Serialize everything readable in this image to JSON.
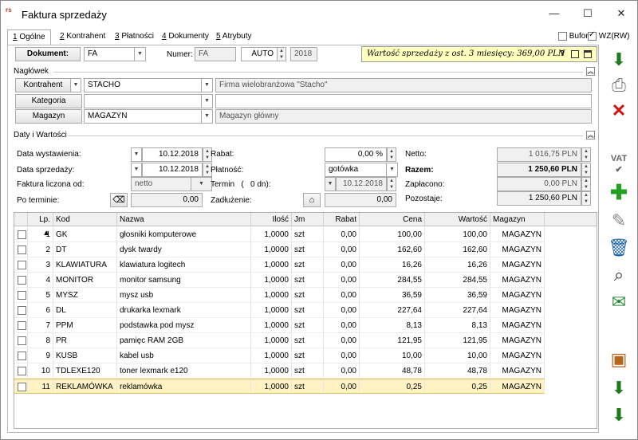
{
  "window": {
    "title": "Faktura sprzedaży",
    "app_icon": "rs",
    "minimize": "—",
    "maximize": "☐",
    "close": "✕"
  },
  "tabs": [
    {
      "num": "1",
      "label": "Ogólne"
    },
    {
      "num": "2",
      "label": "Kontrahent"
    },
    {
      "num": "3",
      "label": "Płatności"
    },
    {
      "num": "4",
      "label": "Dokumenty"
    },
    {
      "num": "5",
      "label": "Atrybuty"
    }
  ],
  "options": {
    "bufor": "Bufor",
    "wz": "WZ(RW)",
    "bufor_checked": false,
    "wz_checked": true
  },
  "doc": {
    "dokument_label": "Dokument:",
    "dokument_value": "FA",
    "numer_label": "Numer:",
    "numer_prefix": "FA",
    "numer_auto": "AUTO",
    "numer_year": "2018"
  },
  "sales_info": {
    "text": "Wartość sprzedaży z ost. 3 miesięcy: 369,00 PLN",
    "help": "?"
  },
  "naglowek": {
    "title": "Nagłówek",
    "kontrahent_label": "Kontrahent",
    "kontrahent_value": "STACHO",
    "kontrahent_name": "Firma wielobranżowa \"Stacho\"",
    "kategoria_label": "Kategoria",
    "kategoria_value": "",
    "kategoria_desc": "",
    "magazyn_label": "Magazyn",
    "magazyn_value": "MAGAZYN",
    "magazyn_name": "Magazyn główny"
  },
  "daty": {
    "title": "Daty i Wartości",
    "data_wyst_label": "Data wystawienia:",
    "data_wyst": "10.12.2018",
    "data_sprz_label": "Data sprzedaży:",
    "data_sprz": "10.12.2018",
    "faktura_od_label": "Faktura liczona od:",
    "faktura_od": "netto",
    "po_terminie_label": "Po terminie:",
    "po_terminie": "0,00",
    "rabat_label": "Rabat:",
    "rabat": "0,00 %",
    "platnosc_label": "Płatność:",
    "platnosc": "gotówka",
    "termin_label": "Termin   (   0 dn):",
    "termin": "10.12.2018",
    "zadluzenie_label": "Zadłużenie:",
    "zadluzenie": "0,00",
    "netto_label": "Netto:",
    "netto": "1 016,75 PLN",
    "razem_label": "Razem:",
    "razem": "1 250,60 PLN",
    "zaplacono_label": "Zapłacono:",
    "zaplacono": "0,00 PLN",
    "pozostaje_label": "Pozostaje:",
    "pozostaje": "1 250,60 PLN"
  },
  "table": {
    "headers": {
      "lp": "Lp.",
      "kod": "Kod",
      "nazwa": "Nazwa",
      "ilosc": "Ilość",
      "jm": "Jm",
      "rabat": "Rabat",
      "cena": "Cena",
      "wartosc": "Wartość",
      "magazyn": "Magazyn"
    },
    "rows": [
      {
        "lp": "1",
        "kod": "GK",
        "nazwa": "głosniki komputerowe",
        "ilosc": "1,0000",
        "jm": "szt",
        "rabat": "0,00",
        "cena": "100,00",
        "wartosc": "100,00",
        "magazyn": "MAGAZYN"
      },
      {
        "lp": "2",
        "kod": "DT",
        "nazwa": "dysk twardy",
        "ilosc": "1,0000",
        "jm": "szt",
        "rabat": "0,00",
        "cena": "162,60",
        "wartosc": "162,60",
        "magazyn": "MAGAZYN"
      },
      {
        "lp": "3",
        "kod": "KLAWIATURA",
        "nazwa": "klawiatura logitech",
        "ilosc": "1,0000",
        "jm": "szt",
        "rabat": "0,00",
        "cena": "16,26",
        "wartosc": "16,26",
        "magazyn": "MAGAZYN"
      },
      {
        "lp": "4",
        "kod": "MONITOR",
        "nazwa": "monitor samsung",
        "ilosc": "1,0000",
        "jm": "szt",
        "rabat": "0,00",
        "cena": "284,55",
        "wartosc": "284,55",
        "magazyn": "MAGAZYN"
      },
      {
        "lp": "5",
        "kod": "MYSZ",
        "nazwa": "mysz usb",
        "ilosc": "1,0000",
        "jm": "szt",
        "rabat": "0,00",
        "cena": "36,59",
        "wartosc": "36,59",
        "magazyn": "MAGAZYN"
      },
      {
        "lp": "6",
        "kod": "DL",
        "nazwa": "drukarka lexmark",
        "ilosc": "1,0000",
        "jm": "szt",
        "rabat": "0,00",
        "cena": "227,64",
        "wartosc": "227,64",
        "magazyn": "MAGAZYN"
      },
      {
        "lp": "7",
        "kod": "PPM",
        "nazwa": "podstawka pod mysz",
        "ilosc": "1,0000",
        "jm": "szt",
        "rabat": "0,00",
        "cena": "8,13",
        "wartosc": "8,13",
        "magazyn": "MAGAZYN"
      },
      {
        "lp": "8",
        "kod": "PR",
        "nazwa": "pamięc RAM 2GB",
        "ilosc": "1,0000",
        "jm": "szt",
        "rabat": "0,00",
        "cena": "121,95",
        "wartosc": "121,95",
        "magazyn": "MAGAZYN"
      },
      {
        "lp": "9",
        "kod": "KUSB",
        "nazwa": "kabel usb",
        "ilosc": "1,0000",
        "jm": "szt",
        "rabat": "0,00",
        "cena": "10,00",
        "wartosc": "10,00",
        "magazyn": "MAGAZYN"
      },
      {
        "lp": "10",
        "kod": "TDLEXE120",
        "nazwa": "toner lexmark e120",
        "ilosc": "1,0000",
        "jm": "szt",
        "rabat": "0,00",
        "cena": "48,78",
        "wartosc": "48,78",
        "magazyn": "MAGAZYN"
      },
      {
        "lp": "11",
        "kod": "REKLAMÓWKA",
        "nazwa": "reklamówka",
        "ilosc": "1,0000",
        "jm": "szt",
        "rabat": "0,00",
        "cena": "0,25",
        "wartosc": "0,25",
        "magazyn": "MAGAZYN"
      }
    ]
  },
  "toolbar": {
    "vat_label": "VAT"
  }
}
